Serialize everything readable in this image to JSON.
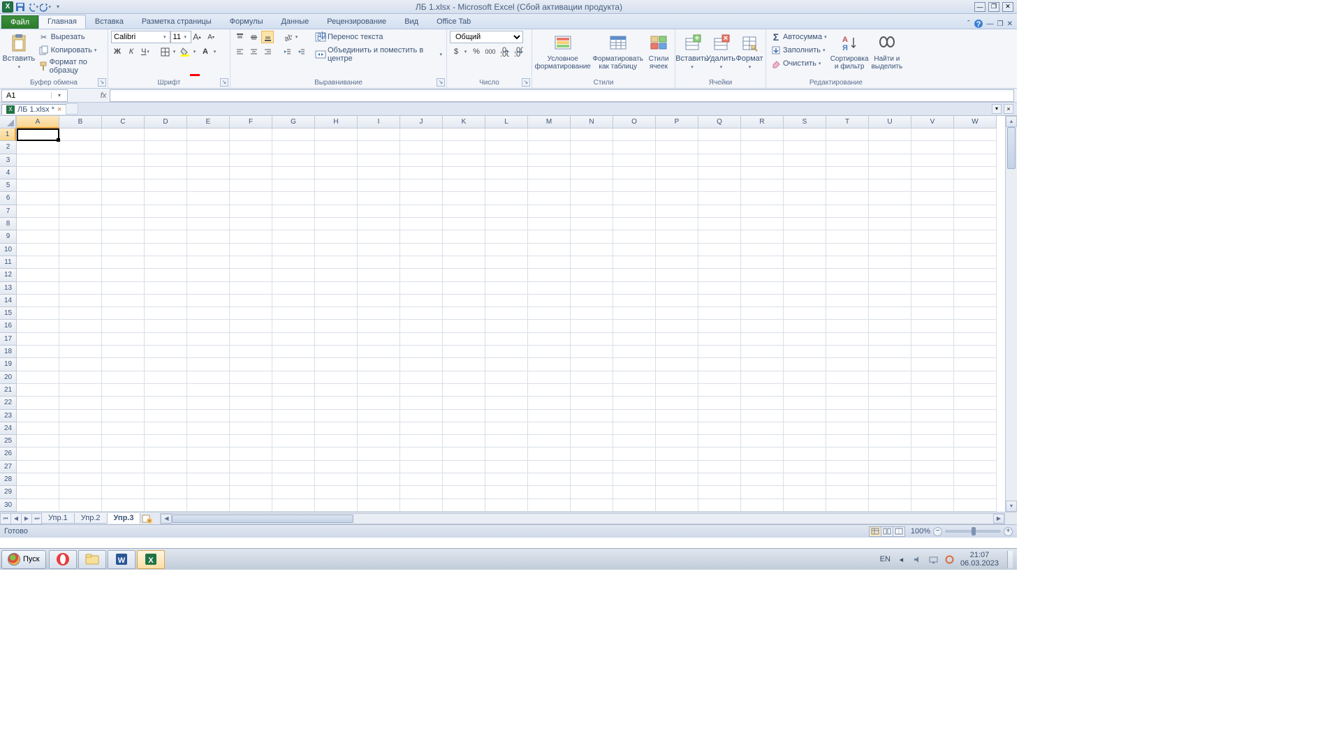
{
  "titlebar": {
    "title": "ЛБ 1.xlsx - Microsoft Excel (Сбой активации продукта)"
  },
  "tabs": {
    "file": "Файл",
    "items": [
      "Главная",
      "Вставка",
      "Разметка страницы",
      "Формулы",
      "Данные",
      "Рецензирование",
      "Вид",
      "Office Tab"
    ],
    "active": 0
  },
  "ribbon": {
    "clipboard": {
      "title": "Буфер обмена",
      "paste": "Вставить",
      "cut": "Вырезать",
      "copy": "Копировать",
      "painter": "Формат по образцу"
    },
    "font": {
      "title": "Шрифт",
      "name": "Calibri",
      "size": "11"
    },
    "align": {
      "title": "Выравнивание",
      "wrap": "Перенос текста",
      "merge": "Объединить и поместить в центре"
    },
    "number": {
      "title": "Число",
      "format": "Общий"
    },
    "styles": {
      "title": "Стили",
      "cond": "Условное\nформатирование",
      "table": "Форматировать\nкак таблицу",
      "cellstyles": "Стили\nячеек"
    },
    "cells": {
      "title": "Ячейки",
      "insert": "Вставить",
      "delete": "Удалить",
      "format": "Формат"
    },
    "editing": {
      "title": "Редактирование",
      "autosum": "Автосумма",
      "fill": "Заполнить",
      "clear": "Очистить",
      "sort": "Сортировка\nи фильтр",
      "find": "Найти и\nвыделить"
    }
  },
  "namebox": "A1",
  "doctab": {
    "name": "ЛБ 1.xlsx *"
  },
  "columns": [
    "A",
    "B",
    "C",
    "D",
    "E",
    "F",
    "G",
    "H",
    "I",
    "J",
    "K",
    "L",
    "M",
    "N",
    "O",
    "P",
    "Q",
    "R",
    "S",
    "T",
    "U",
    "V",
    "W"
  ],
  "rows": 30,
  "sheets": {
    "list": [
      "Упр.1",
      "Упр.2",
      "Упр.3"
    ],
    "active": 2
  },
  "status": {
    "ready": "Готово",
    "zoom": "100%"
  },
  "taskbar": {
    "start": "Пуск",
    "lang": "EN",
    "time": "21:07",
    "date": "06.03.2023"
  }
}
